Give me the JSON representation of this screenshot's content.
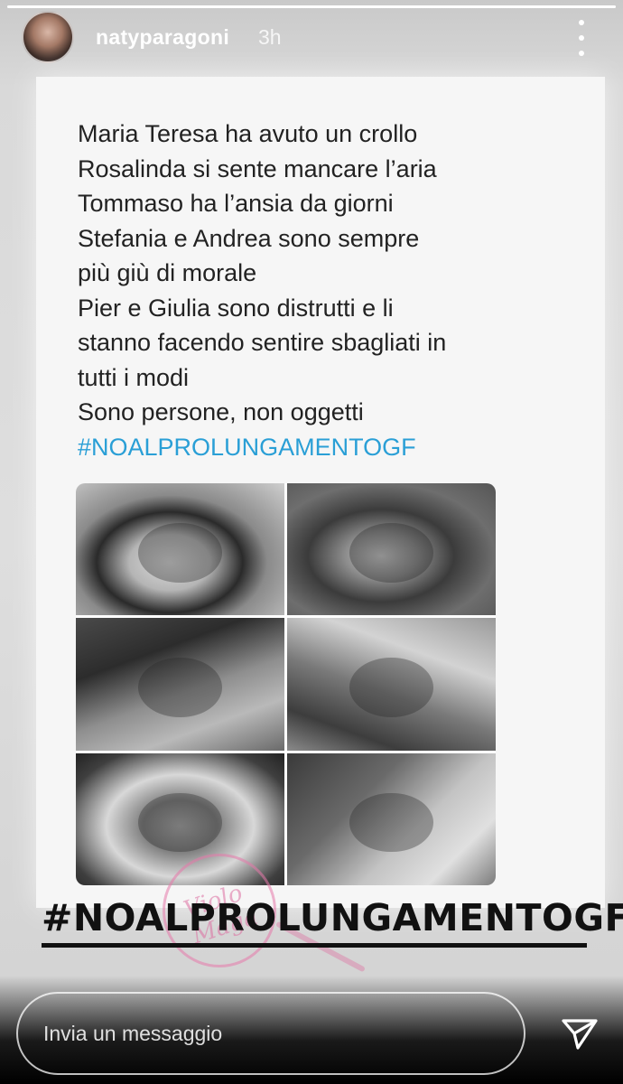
{
  "header": {
    "username": "natyparagoni",
    "time": "3h",
    "avatar_icon": "profile-avatar",
    "menu_icon": "more-vertical-icon"
  },
  "story": {
    "progress": 1.0,
    "tweet_lines": [
      "Maria Teresa ha avuto un crollo",
      "Rosalinda si sente mancare l’aria",
      "Tommaso ha l’ansia da giorni",
      "Stefania e Andrea sono sempre",
      "più giù di morale",
      "Pier e Giulia sono distrutti e li",
      "stanno facendo sentire sbagliati in",
      "tutti i modi",
      "Sono persone, non oggetti"
    ],
    "tweet_hashtag": "#NOALPROLUNGAMENTOGF",
    "sticker_hashtag": "#NOALPROLUNGAMENTOGF",
    "watermark_text": "Violo Maga",
    "colors": {
      "hashtag_blue": "#2a9fd6",
      "username": "#ffffff"
    }
  },
  "footer": {
    "message_placeholder": "Invia un messaggio",
    "send_icon": "paper-plane-icon"
  }
}
